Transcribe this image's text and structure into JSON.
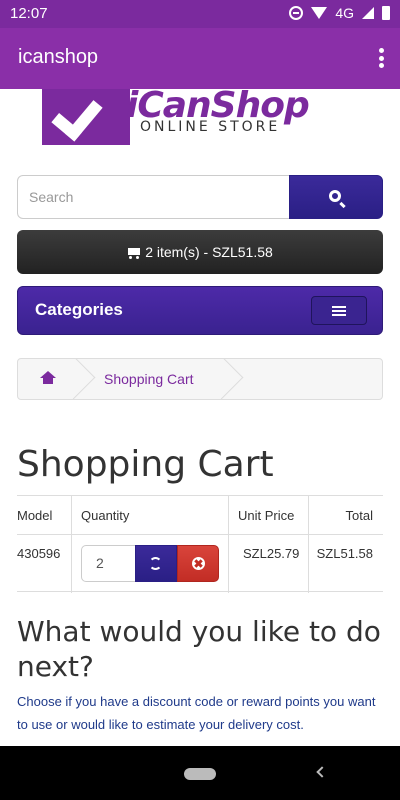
{
  "status_bar": {
    "time": "12:07",
    "network": "4G"
  },
  "app_bar": {
    "title": "icanshop"
  },
  "logo": {
    "name": "iCanShop",
    "tagline": "ONLINE STORE"
  },
  "search": {
    "placeholder": "Search"
  },
  "cart_button": {
    "label": "2 item(s) - SZL51.58"
  },
  "categories": {
    "label": "Categories"
  },
  "breadcrumb": {
    "items": [
      "Shopping Cart"
    ]
  },
  "page_title": "Shopping Cart",
  "cart_table": {
    "headers": [
      "Model",
      "Quantity",
      "Unit Price",
      "Total"
    ],
    "rows": [
      {
        "model": "430596",
        "quantity": "2",
        "unit_price": "SZL25.79",
        "total": "SZL51.58"
      }
    ]
  },
  "next_section": {
    "heading": "What would you like to do next?",
    "description": "Choose if you have a discount code or reward points you want to use or would like to estimate your delivery cost."
  },
  "colors": {
    "brand": "#8a2fa8",
    "primary_button": "#2a1f85",
    "danger": "#c22d25",
    "link": "#7b2a9e"
  }
}
